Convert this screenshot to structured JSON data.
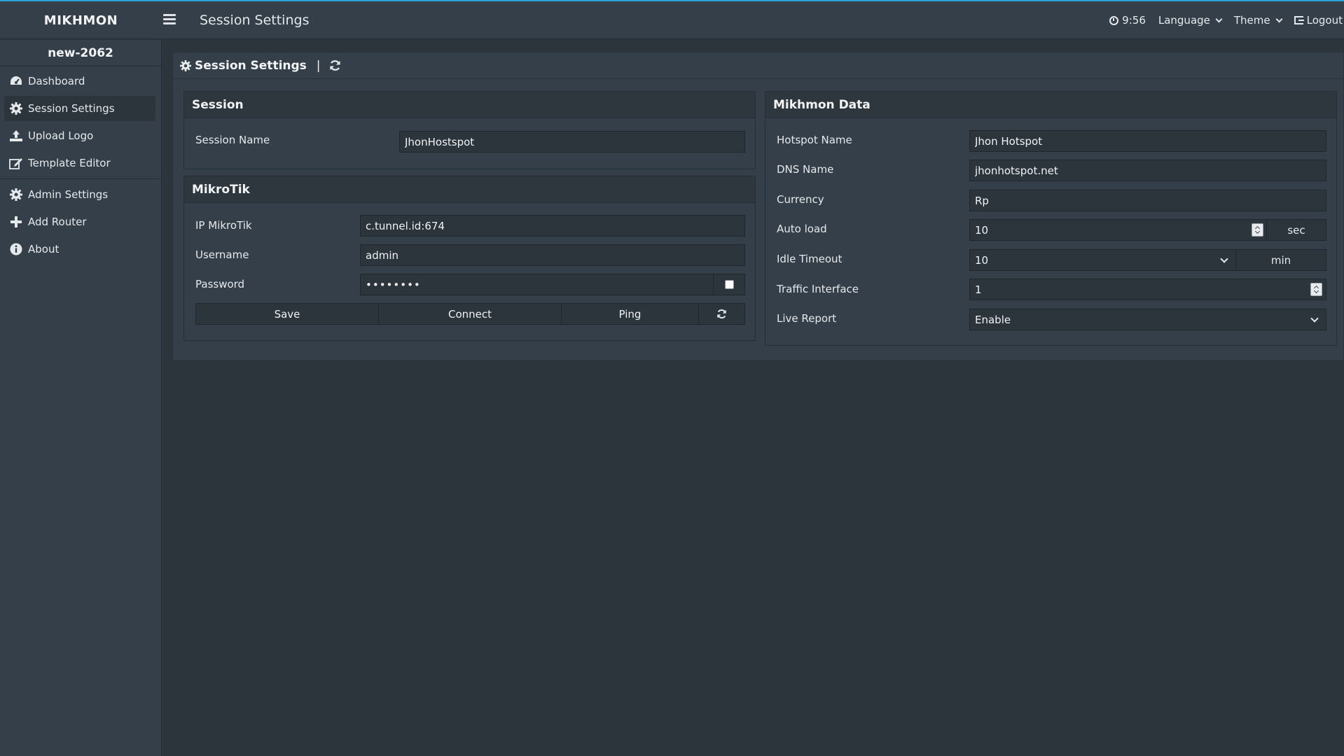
{
  "app": {
    "brand": "MIKHMON",
    "page_title": "Session Settings"
  },
  "topbar": {
    "time": "9:56",
    "language_label": "Language",
    "theme_label": "Theme",
    "logout_label": "Logout"
  },
  "sidebar": {
    "router_name": "new-2062",
    "items": [
      {
        "label": "Dashboard",
        "icon": "dashboard-icon"
      },
      {
        "label": "Session Settings",
        "icon": "gear-icon",
        "active": true
      },
      {
        "label": "Upload Logo",
        "icon": "upload-icon"
      },
      {
        "label": "Template Editor",
        "icon": "edit-icon"
      },
      {
        "label": "Admin Settings",
        "icon": "gear-icon"
      },
      {
        "label": "Add Router",
        "icon": "plus-icon"
      },
      {
        "label": "About",
        "icon": "info-icon"
      }
    ]
  },
  "content": {
    "header_title": "Session Settings",
    "header_separator": "|",
    "session": {
      "title": "Session",
      "session_name_label": "Session Name",
      "session_name_value": "JhonHostspot"
    },
    "mikrotik": {
      "title": "MikroTik",
      "ip_label": "IP MikroTik",
      "ip_value": "c.tunnel.id:674",
      "username_label": "Username",
      "username_value": "admin",
      "password_label": "Password",
      "password_value": "••••••••",
      "save_label": "Save",
      "connect_label": "Connect",
      "ping_label": "Ping"
    },
    "mikhmon_data": {
      "title": "Mikhmon Data",
      "hotspot_name_label": "Hotspot Name",
      "hotspot_name_value": "Jhon Hotspot",
      "dns_name_label": "DNS Name",
      "dns_name_value": "jhonhotspot.net",
      "currency_label": "Currency",
      "currency_value": "Rp",
      "auto_load_label": "Auto load",
      "auto_load_value": "10",
      "auto_load_unit": "sec",
      "idle_timeout_label": "Idle Timeout",
      "idle_timeout_value": "10",
      "idle_timeout_unit": "min",
      "traffic_interface_label": "Traffic Interface",
      "traffic_interface_value": "1",
      "live_report_label": "Live Report",
      "live_report_value": "Enable"
    }
  },
  "colors": {
    "accent": "#2f9fd8",
    "panel_bg": "#353f49",
    "page_bg": "#2c343c"
  }
}
